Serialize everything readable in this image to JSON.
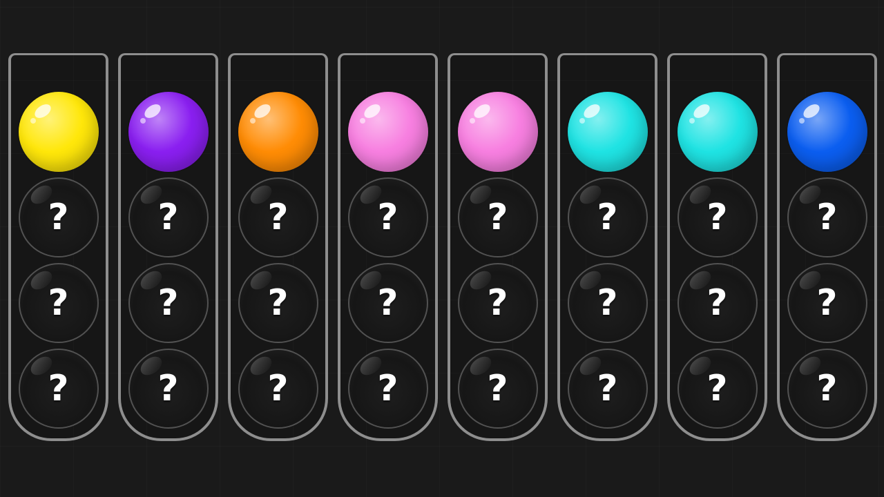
{
  "board": {
    "hidden_symbol": "?",
    "tubes": [
      {
        "top_color_name": "yellow",
        "top_color": "#ffe70a",
        "hidden_count": 3
      },
      {
        "top_color_name": "purple",
        "top_color": "#8a1ff0",
        "hidden_count": 3
      },
      {
        "top_color_name": "orange",
        "top_color": "#ff8c05",
        "hidden_count": 3
      },
      {
        "top_color_name": "pink",
        "top_color": "#f77fe0",
        "hidden_count": 3
      },
      {
        "top_color_name": "pink",
        "top_color": "#f77fe0",
        "hidden_count": 3
      },
      {
        "top_color_name": "cyan",
        "top_color": "#1fe3e3",
        "hidden_count": 3
      },
      {
        "top_color_name": "cyan",
        "top_color": "#1fe3e3",
        "hidden_count": 3
      },
      {
        "top_color_name": "blue",
        "top_color": "#0b5ef0",
        "hidden_count": 3
      }
    ]
  }
}
